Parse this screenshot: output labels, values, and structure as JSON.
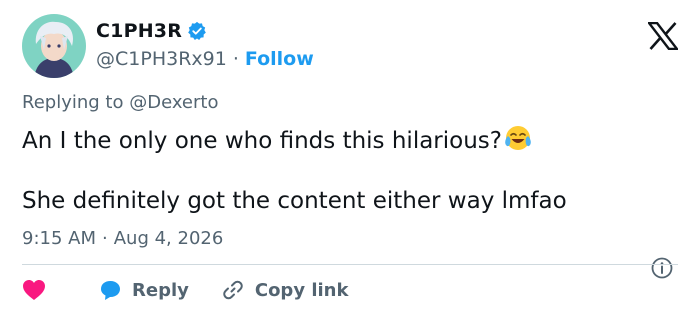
{
  "author": {
    "display_name": "C1PH3R",
    "handle": "@C1PH3Rx91",
    "separator": "·",
    "follow_label": "Follow",
    "verified": true
  },
  "reply_context": {
    "prefix": "Replying to",
    "mention": "@Dexerto"
  },
  "tweet": {
    "line1": "An I the only one who finds this hilarious?",
    "line1_emoji": "face-with-tears-of-joy",
    "line2": "She definitely got the content either way lmfao"
  },
  "meta": {
    "time": "9:15 AM",
    "separator": "·",
    "date": "Aug 4, 2026"
  },
  "actions": {
    "like_icon": "heart-icon",
    "reply_label": "Reply",
    "copy_label": "Copy link"
  },
  "colors": {
    "accent": "#1d9bf0",
    "like": "#f91880",
    "secondary_text": "#536471",
    "divider": "#cfd9de"
  }
}
